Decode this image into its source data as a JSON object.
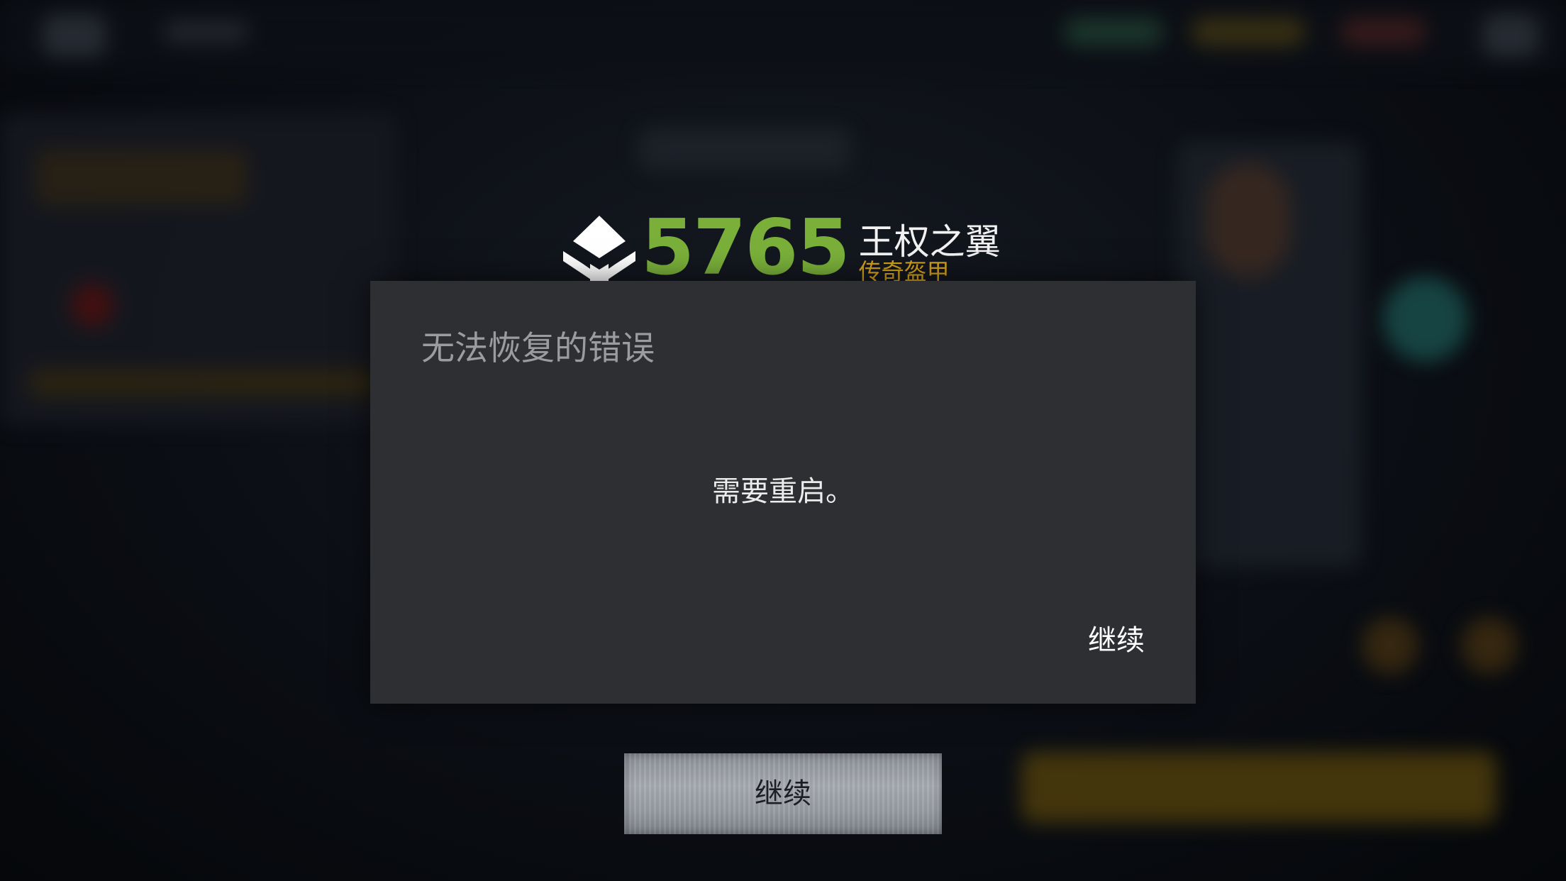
{
  "item": {
    "power_value": "5765",
    "name": "王权之翼",
    "rarity": "传奇盔甲",
    "icon": "power-level-diamond-icon"
  },
  "dialog": {
    "title": "无法恢复的错误",
    "message": "需要重启。",
    "action_label": "继续"
  },
  "footer": {
    "continue_label": "继续"
  },
  "colors": {
    "power_green": "#7ab03a",
    "rarity_gold": "#d4a21a",
    "dialog_bg": "#2e2f33"
  }
}
